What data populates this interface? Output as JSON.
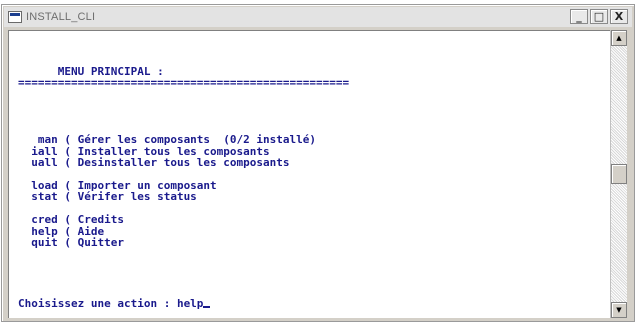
{
  "window": {
    "title": "INSTALL_CLI",
    "buttons": {
      "minimize": "_",
      "maximize": "□",
      "close": "X"
    }
  },
  "console": {
    "lines": [
      "      MENU PRINCIPAL :",
      "==================================================",
      "",
      "",
      "",
      "",
      "   man ( Gérer les composants  (0/2 installé)",
      "  iall ( Installer tous les composants",
      "  uall ( Desinstaller tous les composants",
      "",
      "  load ( Importer un composant",
      "  stat ( Vérifer les status",
      "",
      "  cred ( Credits",
      "  help ( Aide",
      "  quit ( Quitter"
    ],
    "prompt": "Choisissez une action : help"
  },
  "scrollbar": {
    "up_icon": "triangle-up-icon",
    "down_icon": "triangle-down-icon"
  },
  "colors": {
    "text": "#1a1a8c",
    "background": "#ffffff",
    "chrome": "#d4d0c8"
  }
}
